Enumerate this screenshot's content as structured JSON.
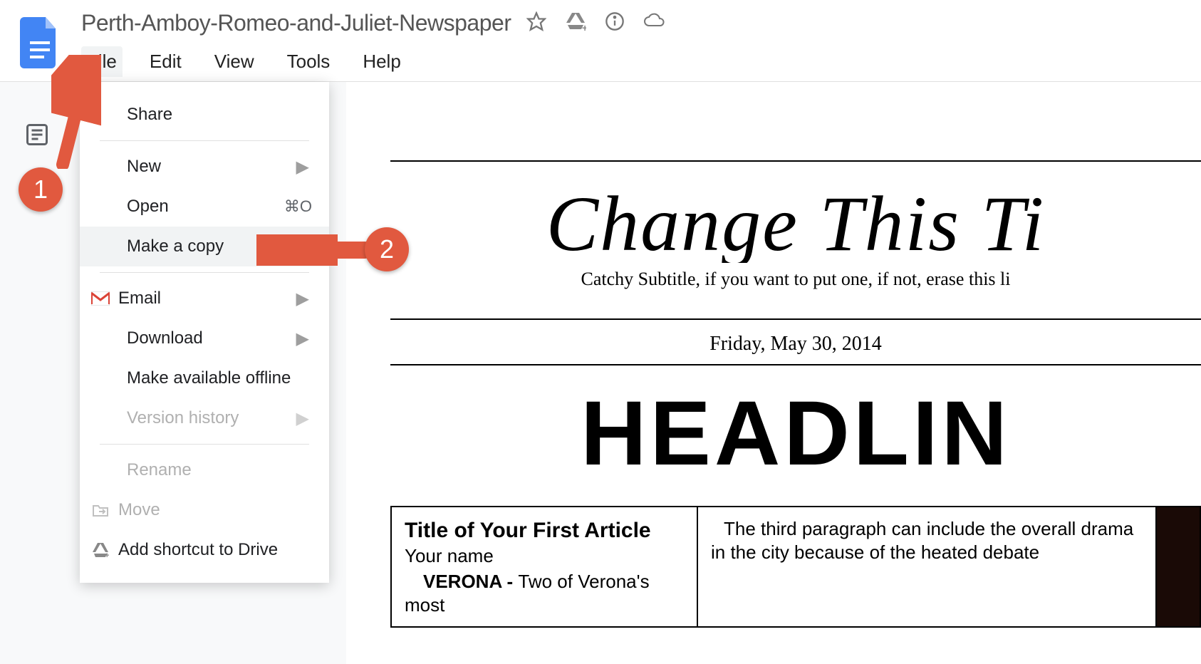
{
  "header": {
    "doc_title": "Perth-Amboy-Romeo-and-Juliet-Newspaper",
    "menu": [
      "File",
      "Edit",
      "View",
      "Tools",
      "Help"
    ]
  },
  "dropdown": {
    "share": "Share",
    "new": "New",
    "open": "Open",
    "open_shortcut": "⌘O",
    "make_a_copy": "Make a copy",
    "email": "Email",
    "download": "Download",
    "make_offline": "Make available offline",
    "version_history": "Version history",
    "rename": "Rename",
    "move": "Move",
    "add_shortcut": "Add shortcut to Drive"
  },
  "document": {
    "masthead": "Change This Ti",
    "subtitle": "Catchy Subtitle, if you want to put one, if not, erase this li",
    "date": "Friday, May 30, 2014",
    "headline": "HEADLIN",
    "col1_title": "Title of Your First Article",
    "col1_byline": "Your name",
    "col1_line": "VERONA - Two of Verona's most",
    "col2_text": "The third paragraph can include the overall drama in the city because of the heated debate"
  },
  "annotations": {
    "callout1": "1",
    "callout2": "2"
  }
}
